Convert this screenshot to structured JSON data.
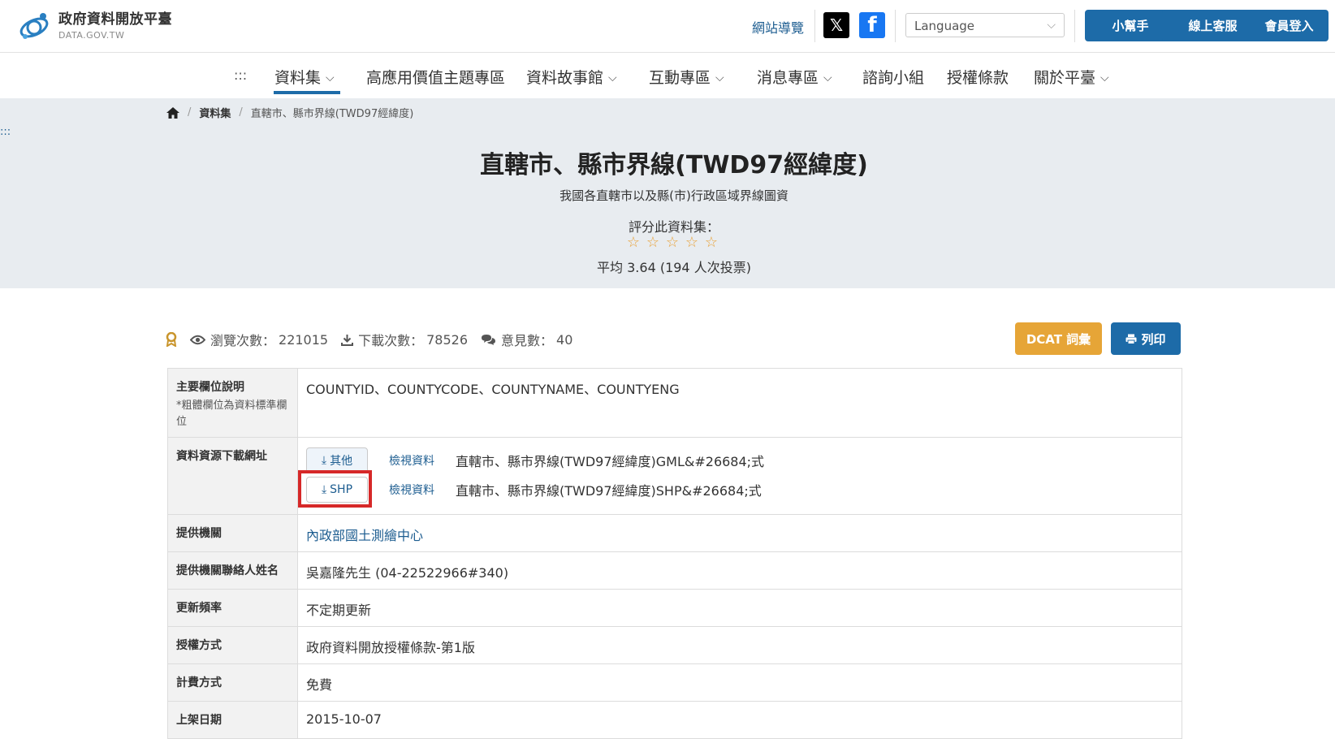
{
  "header": {
    "logo_title": "政府資料開放平臺",
    "logo_sub": "DATA.GOV.TW",
    "sitemap": "網站導覽",
    "language_placeholder": "Language",
    "buttons": {
      "helper": "小幫手",
      "support": "線上客服",
      "login": "會員登入"
    },
    "icons": {
      "x": "x-social-icon",
      "facebook": "facebook-icon"
    },
    "accent_color": "#1d6ba8"
  },
  "nav": {
    "dots": ":::",
    "items": [
      {
        "label": "資料集",
        "has_dropdown": true,
        "active": true
      },
      {
        "label": "高應用價值主題專區",
        "has_dropdown": false
      },
      {
        "label": "資料故事館",
        "has_dropdown": true
      },
      {
        "label": "互動專區",
        "has_dropdown": true
      },
      {
        "label": "消息專區",
        "has_dropdown": true
      },
      {
        "label": "諮詢小組",
        "has_dropdown": false
      },
      {
        "label": "授權條款",
        "has_dropdown": false
      },
      {
        "label": "關於平臺",
        "has_dropdown": true
      }
    ]
  },
  "breadcrumb": {
    "home_icon": "home-icon",
    "items": [
      "資料集",
      "直轄市、縣市界線(TWD97經緯度)"
    ]
  },
  "left_dots": ":::",
  "dataset": {
    "title": "直轄市、縣市界線(TWD97經緯度)",
    "description": "我國各直轄市以及縣(市)行政區域界線圖資",
    "rate_label": "評分此資料集：",
    "star_count": 5,
    "average": "平均 3.64 (194 人次投票)"
  },
  "stats": {
    "badge_icon": "award-icon",
    "views_label": "瀏覽次數：",
    "views": "221015",
    "downloads_label": "下載次數：",
    "downloads": "78526",
    "comments_label": "意見數：",
    "comments": "40"
  },
  "actions": {
    "dcat": "DCAT 詞彙",
    "print": "列印"
  },
  "table": {
    "fields_label": "主要欄位說明",
    "fields_note": "*粗體欄位為資料標準欄位",
    "fields_value": "COUNTYID、COUNTYCODE、COUNTYNAME、COUNTYENG",
    "resources_label": "資料資源下載網址",
    "resources": [
      {
        "button": "其他",
        "view": "檢視資料",
        "name": "直轄市、縣市界線(TWD97經緯度)GML&#26684;式"
      },
      {
        "button": "SHP",
        "view": "檢視資料",
        "name": "直轄市、縣市界線(TWD97經緯度)SHP&#26684;式"
      }
    ],
    "provider_label": "提供機關",
    "provider_value": "內政部國土測繪中心",
    "contact_label": "提供機關聯絡人姓名",
    "contact_value": "吳嘉隆先生 (04-22522966#340)",
    "frequency_label": "更新頻率",
    "frequency_value": "不定期更新",
    "license_label": "授權方式",
    "license_value": "政府資料開放授權條款-第1版",
    "fee_label": "計費方式",
    "fee_value": "免費",
    "date_label": "上架日期",
    "date_value": "2015-10-07"
  }
}
